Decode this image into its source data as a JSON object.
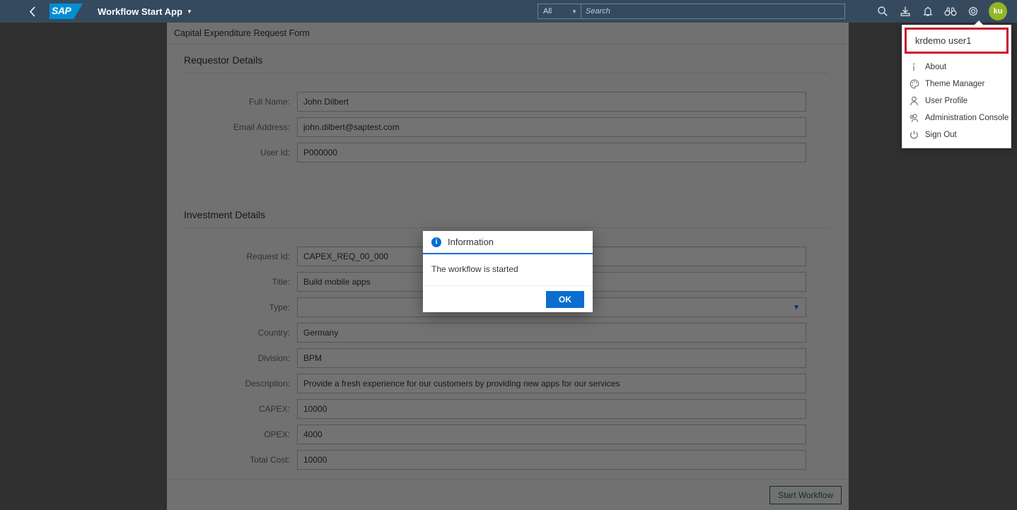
{
  "header": {
    "back_icon": "chevron-left-icon",
    "logo_text": "SAP",
    "app_title": "Workflow Start App",
    "search": {
      "scope_value": "All",
      "placeholder": "Search"
    },
    "icons": [
      {
        "name": "search-icon",
        "label": "Search"
      },
      {
        "name": "download-icon",
        "label": "Download"
      },
      {
        "name": "bell-icon",
        "label": "Notifications"
      },
      {
        "name": "binoculars-icon",
        "label": "Discovery"
      },
      {
        "name": "gear-icon",
        "label": "Settings"
      }
    ],
    "avatar": {
      "initials": "ku",
      "color": "#93b527"
    }
  },
  "user_menu": {
    "user_name": "krdemo user1",
    "highlight_color": "#c9142c",
    "items": [
      {
        "icon": "info-icon",
        "label": "About"
      },
      {
        "icon": "palette-icon",
        "label": "Theme Manager"
      },
      {
        "icon": "person-icon",
        "label": "User Profile"
      },
      {
        "icon": "person-gear-icon",
        "label": "Administration Console"
      },
      {
        "icon": "power-icon",
        "label": "Sign Out"
      }
    ]
  },
  "page": {
    "title": "Capital Expenditure Request Form",
    "sections": [
      {
        "title": "Requestor Details",
        "fields": [
          {
            "label": "Full Name:",
            "value": "John Dilbert",
            "type": "text"
          },
          {
            "label": "Email Address:",
            "value": "john.dilbert@saptest.com",
            "type": "text"
          },
          {
            "label": "User Id:",
            "value": "P000000",
            "type": "text"
          }
        ]
      },
      {
        "title": "Investment Details",
        "fields": [
          {
            "label": "Request Id:",
            "value": "CAPEX_REQ_00_000",
            "type": "text"
          },
          {
            "label": "Title:",
            "value": "Build mobile apps",
            "type": "text"
          },
          {
            "label": "Type:",
            "value": "",
            "type": "select"
          },
          {
            "label": "Country:",
            "value": "Germany",
            "type": "text"
          },
          {
            "label": "Division:",
            "value": "BPM",
            "type": "text"
          },
          {
            "label": "Description:",
            "value": "Provide a fresh experience for our customers by providing new apps for our services",
            "type": "text"
          },
          {
            "label": "CAPEX:",
            "value": "10000",
            "type": "text"
          },
          {
            "label": "OPEX:",
            "value": "4000",
            "type": "text"
          },
          {
            "label": "Total Cost:",
            "value": "10000",
            "type": "text"
          }
        ]
      }
    ],
    "footer": {
      "start_button_label": "Start Workflow",
      "start_button_color": "#2b6b4f"
    }
  },
  "dialog": {
    "icon": "info-circle-icon",
    "title": "Information",
    "message": "The workflow is started",
    "ok_label": "OK",
    "accent_color": "#0a6ed1"
  }
}
